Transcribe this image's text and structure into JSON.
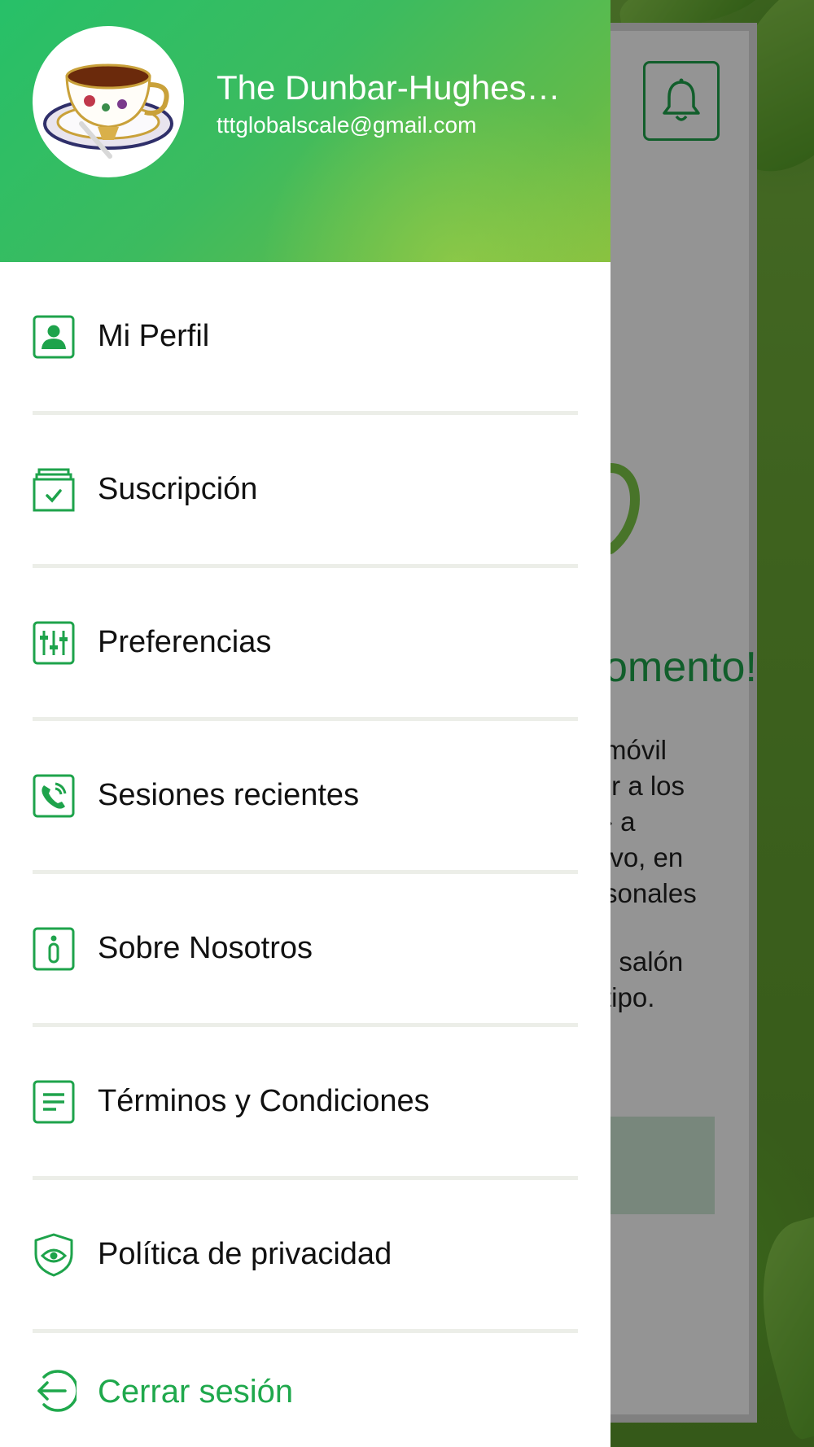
{
  "colors": {
    "accent": "#1ea34b",
    "header_gradient_start": "#27c068",
    "header_gradient_end": "#86c03f",
    "logout_text": "#1fa84c"
  },
  "header": {
    "avatar_icon": "teacup-avatar",
    "user_name": "The Dunbar-Hughes…",
    "user_email": "tttglobalscale@gmail.com"
  },
  "menu": {
    "items": [
      {
        "icon": "profile-icon",
        "label": "Mi Perfil"
      },
      {
        "icon": "subscription-icon",
        "label": "Suscripción"
      },
      {
        "icon": "preferences-sliders-icon",
        "label": "Preferencias"
      },
      {
        "icon": "phone-call-icon",
        "label": "Sesiones recientes"
      },
      {
        "icon": "info-icon",
        "label": "Sobre Nosotros"
      },
      {
        "icon": "document-lines-icon",
        "label": "Términos y Condiciones"
      },
      {
        "icon": "privacy-shield-eye-icon",
        "label": "Política de privacidad"
      }
    ],
    "logout": {
      "icon": "logout-arrow-icon",
      "label": "Cerrar sesión"
    }
  },
  "background": {
    "bell_icon": "bell-icon",
    "headline": "omento!",
    "paragraph_lines": [
      "móvil",
      "ır a los",
      "› a",
      "ivo, en",
      "sonales"
    ],
    "paragraph2_lines": [
      "ı salón",
      "tipo."
    ]
  }
}
